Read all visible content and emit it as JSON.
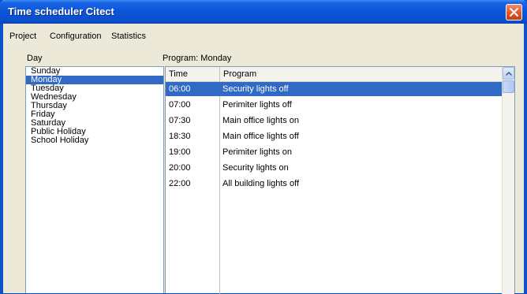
{
  "window": {
    "title": "Time scheduler Citect"
  },
  "menu": [
    "Project",
    "Configuration",
    "Statistics"
  ],
  "day_panel": {
    "label": "Day",
    "items": [
      "Sunday",
      "Monday",
      "Tuesday",
      "Wednesday",
      "Thursday",
      "Friday",
      "Saturday",
      "Public Holiday",
      "School Holiday"
    ],
    "selected": "Monday"
  },
  "program_panel": {
    "label": "Program: Monday",
    "columns": [
      "Time",
      "Program"
    ],
    "rows": [
      {
        "time": "06:00",
        "program": "Security lights off"
      },
      {
        "time": "07:00",
        "program": "Perimiter lights off"
      },
      {
        "time": "07:30",
        "program": "Main office lights on"
      },
      {
        "time": "18:30",
        "program": "Main office lights off"
      },
      {
        "time": "19:00",
        "program": "Perimiter lights on"
      },
      {
        "time": "20:00",
        "program": "Security lights on"
      },
      {
        "time": "22:00",
        "program": "All building lights off"
      }
    ],
    "selected_row": 0
  },
  "colors": {
    "selection": "#316ac5",
    "titlebar": "#0a55d8",
    "close": "#e55a2f"
  },
  "icons": {
    "close": "close-icon",
    "scroll_up": "chevron-up-icon"
  }
}
